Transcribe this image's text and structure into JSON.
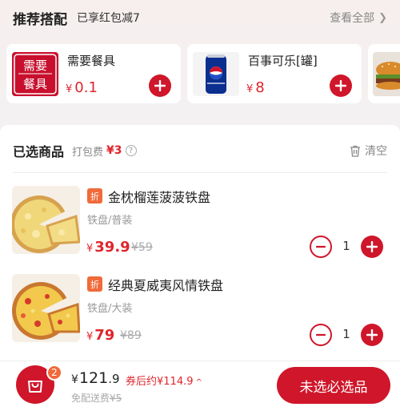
{
  "recommend": {
    "title": "推荐搭配",
    "subtitle": "已享红包减7",
    "more_label": "查看全部",
    "items": [
      {
        "name": "需要餐具",
        "currency": "¥",
        "price": "0.1",
        "icon_text_1": "需要",
        "icon_text_2": "餐具"
      },
      {
        "name": "百事可乐[罐]",
        "currency": "¥",
        "price": "8"
      }
    ]
  },
  "selected": {
    "title": "已选商品",
    "pack_label": "打包费",
    "pack_fee": "¥3",
    "help_glyph": "?",
    "clear_label": "清空",
    "items": [
      {
        "badge": "折",
        "name": "金枕榴莲菠菠铁盘",
        "spec": "铁盘/普装",
        "currency": "¥",
        "price": "39.9",
        "original": "¥59",
        "quantity": "1"
      },
      {
        "badge": "折",
        "name": "经典夏威夷风情铁盘",
        "spec": "铁盘/大装",
        "currency": "¥",
        "price": "79",
        "original": "¥89",
        "quantity": "1"
      }
    ]
  },
  "footer": {
    "cart_count": "2",
    "currency": "¥",
    "total_int": "121",
    "total_dec": ".9",
    "coupon_text": "券后约¥114.9",
    "coupon_arrow": "^",
    "delivery_label": "免配送费",
    "delivery_old": "¥5",
    "checkout_label": "未选必选品"
  },
  "colors": {
    "accent": "#d0162a",
    "price": "#e0252c",
    "discount_badge": "#f06a3a"
  },
  "icons": [
    "chevron-right-icon",
    "plus-icon",
    "minus-icon",
    "help-icon",
    "trash-icon",
    "shopping-bag-icon"
  ]
}
